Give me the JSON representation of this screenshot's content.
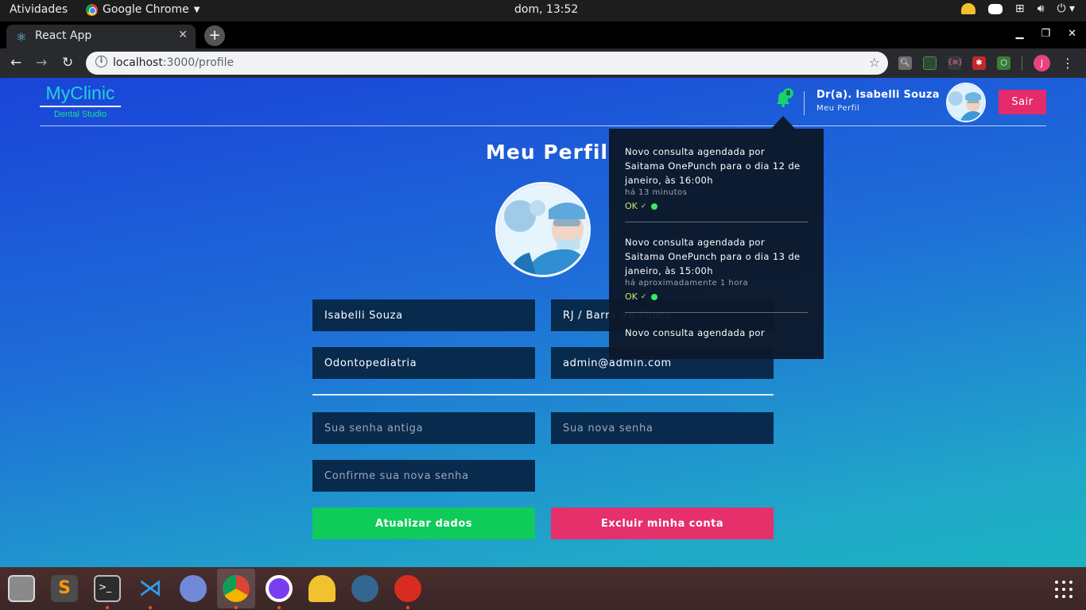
{
  "topbar": {
    "activities": "Atividades",
    "app_name": "Google Chrome",
    "clock": "dom, 13:52"
  },
  "browser": {
    "tab_title": "React App",
    "url_host": "localhost",
    "url_path": ":3000/profile",
    "profile_initial": "J"
  },
  "header": {
    "brand_name": "MyClinic",
    "brand_sub": "Dental Studio",
    "notification_count": "8",
    "user_name": "Dr(a). Isabelli Souza",
    "user_sub": "Meu Perfil",
    "logout_label": "Sair"
  },
  "main": {
    "title": "Meu Perfil",
    "fields": {
      "name": "Isabelli Souza",
      "location": "RJ / Barra da Tijuca",
      "specialty": "Odontopediatria",
      "email": "admin@admin.com"
    },
    "placeholders": {
      "old_password": "Sua senha antiga",
      "new_password": "Sua nova senha",
      "confirm_password": "Confirme sua nova senha"
    },
    "update_label": "Atualizar dados",
    "delete_label": "Excluir minha conta"
  },
  "notifications": [
    {
      "text": "Novo consulta agendada por Saitama OnePunch para o dia 12 de janeiro, às 16:00h",
      "time": "há 13 minutos",
      "ok": "OK"
    },
    {
      "text": "Novo consulta agendada por Saitama OnePunch para o dia 13 de janeiro, às 15:00h",
      "time": "há aproximadamente 1 hora",
      "ok": "OK"
    },
    {
      "text": "Novo consulta agendada por"
    }
  ],
  "dock": {
    "apps": [
      "files-icon",
      "sublime-text-icon",
      "terminal-icon",
      "vscode-icon",
      "discord-icon",
      "chrome-icon",
      "insomnia-icon",
      "beekeeper-icon",
      "pgadmin-icon",
      "redis-icon"
    ]
  },
  "colors": {
    "accent_green": "#0fcb5a",
    "accent_pink": "#e5306c",
    "field_bg": "#082a4d",
    "brand_cyan": "#25d0d8"
  }
}
